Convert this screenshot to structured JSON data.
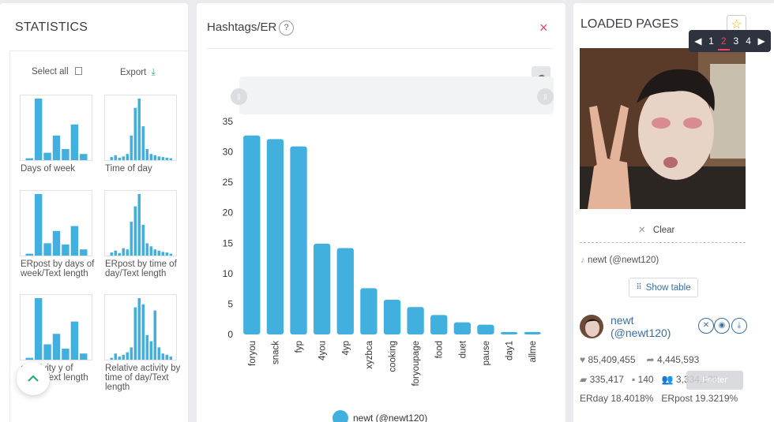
{
  "statistics": {
    "title": "STATISTICS",
    "select_all": "Select all",
    "export": "Export",
    "thumbnails": [
      {
        "label": "Days of week",
        "bars": [
          3,
          100,
          12,
          40,
          18,
          58,
          10
        ]
      },
      {
        "label": "Time of day",
        "bars": [
          5,
          8,
          4,
          6,
          10,
          40,
          85,
          100,
          55,
          18,
          10,
          8,
          6,
          5,
          4,
          3
        ]
      },
      {
        "label": "ERpost by days of week/Text length",
        "bars": [
          3,
          100,
          20,
          40,
          18,
          48,
          10
        ]
      },
      {
        "label": "ERpost by time of day/Text length",
        "bars": [
          5,
          8,
          4,
          12,
          10,
          55,
          80,
          100,
          50,
          20,
          15,
          10,
          8,
          6,
          5,
          3
        ]
      },
      {
        "label": "e activity y of week/Text length",
        "bars": [
          3,
          100,
          25,
          42,
          18,
          62,
          10
        ]
      },
      {
        "label": "Relative activity by time of day/Text length",
        "bars": [
          3,
          10,
          5,
          8,
          12,
          20,
          85,
          100,
          90,
          40,
          30,
          80,
          20,
          10,
          8,
          5
        ]
      }
    ]
  },
  "chart_panel": {
    "title": "Hashtags/ER",
    "help": "?",
    "close": "×",
    "legend": "newt (@newt120)"
  },
  "chart_data": {
    "type": "bar",
    "title": "Hashtags/ER",
    "categories": [
      "foryou",
      "snack",
      "fyp",
      "4you",
      "4yp",
      "xyzbca",
      "cooking",
      "foryoupage",
      "food",
      "duet",
      "pause",
      "day1",
      "allme"
    ],
    "series": [
      {
        "name": "newt (@newt120)",
        "values": [
          32.7,
          32.1,
          30.9,
          14.9,
          14.2,
          7.6,
          5.7,
          4.5,
          3.2,
          2.0,
          1.6,
          0.4,
          0.4
        ]
      }
    ],
    "yticks": [
      0,
      5,
      10,
      15,
      20,
      25,
      30,
      35
    ],
    "ylim": [
      0,
      35
    ],
    "grid": false,
    "legend_position": "bottom",
    "color": "#42b0de"
  },
  "loaded_pages": {
    "title": "LOADED PAGES",
    "pager": {
      "pages": [
        "1",
        "2",
        "3",
        "4"
      ],
      "current": "2"
    },
    "clear": "Clear",
    "user_handle": "newt (@newt120)",
    "show_table": "Show table",
    "profile_name": "newt (@newt120)",
    "likes": "85,409,455",
    "shares": "4,445,593",
    "comments": "335,417",
    "posts": "140",
    "followers": "3,334,138",
    "erday_label": "ERday",
    "erday_value": "18.4018%",
    "erpost_label": "ERpost",
    "erpost_value": "19.3219%",
    "footer": "Footer"
  }
}
